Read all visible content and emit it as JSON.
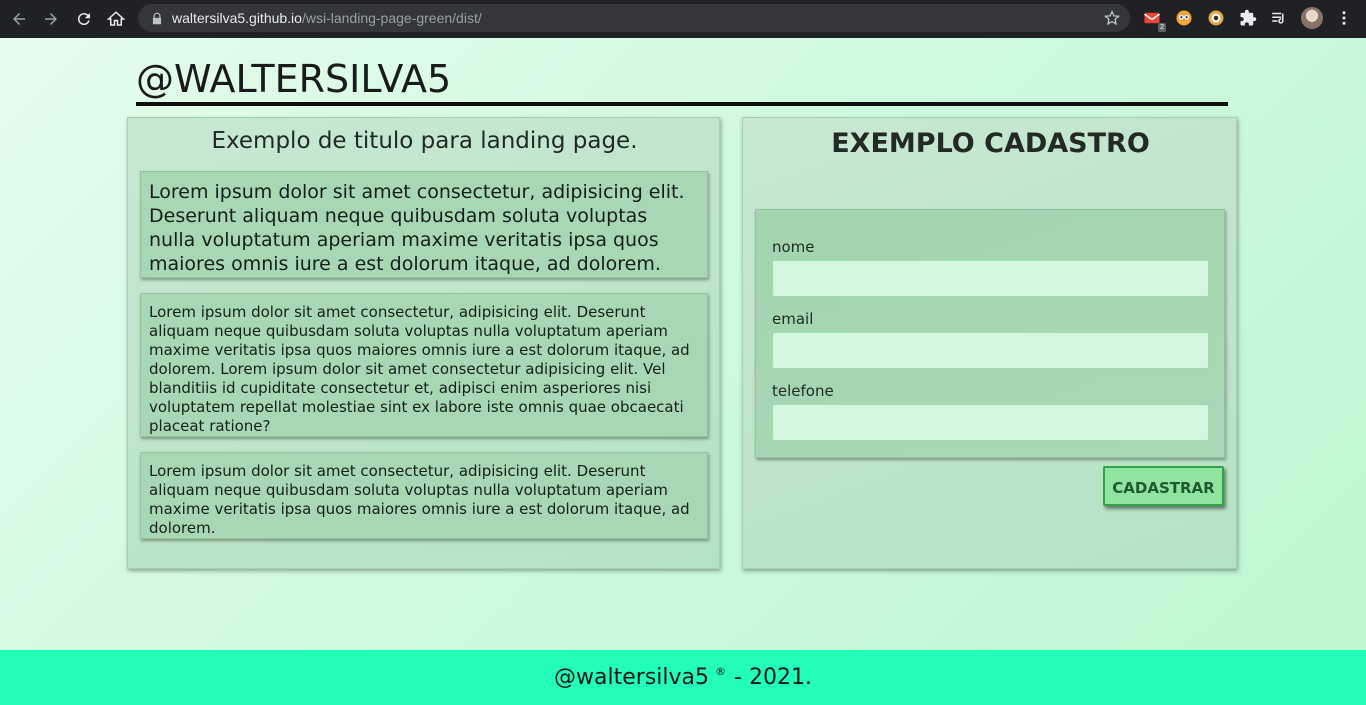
{
  "browser": {
    "url_host": "waltersilva5.github.io",
    "url_path": "/wsi-landing-page-green/dist/",
    "extension_badge": "2",
    "icons": [
      "back-icon",
      "forward-icon",
      "reload-icon",
      "home-icon",
      "lock-icon",
      "star-icon",
      "gmail-icon",
      "eyes-extension-icon",
      "owl-extension-icon",
      "puzzle-icon",
      "reading-list-icon",
      "avatar",
      "menu-icon"
    ]
  },
  "header": {
    "title": "@WALTERSILVA5"
  },
  "left_panel": {
    "title": "Exemplo de titulo para landing page.",
    "cards": [
      "Lorem ipsum dolor sit amet consectetur, adipisicing elit. Deserunt aliquam neque quibusdam soluta voluptas nulla voluptatum aperiam maxime veritatis ipsa quos maiores omnis iure a est dolorum itaque, ad dolorem.",
      "Lorem ipsum dolor sit amet consectetur, adipisicing elit. Deserunt aliquam neque quibusdam soluta voluptas nulla voluptatum aperiam maxime veritatis ipsa quos maiores omnis iure a est dolorum itaque, ad dolorem. Lorem ipsum dolor sit amet consectetur adipisicing elit. Vel blanditiis id cupiditate consectetur et, adipisci enim asperiores nisi voluptatem repellat molestiae sint ex labore iste omnis quae obcaecati placeat ratione?",
      "Lorem ipsum dolor sit amet consectetur, adipisicing elit. Deserunt aliquam neque quibusdam soluta voluptas nulla voluptatum aperiam maxime veritatis ipsa quos maiores omnis iure a est dolorum itaque, ad dolorem."
    ]
  },
  "form": {
    "title": "EXEMPLO CADASTRO",
    "fields": [
      {
        "label": "nome",
        "value": ""
      },
      {
        "label": "email",
        "value": ""
      },
      {
        "label": "telefone",
        "value": ""
      }
    ],
    "submit_label": "CADASTRAR"
  },
  "footer": {
    "handle": "@waltersilva5",
    "mark": "®",
    "year_text": "- 2021."
  },
  "colors": {
    "footer_bg": "#22fdb7",
    "button_bg": "#8fe59f",
    "button_border": "#2fa24a"
  }
}
